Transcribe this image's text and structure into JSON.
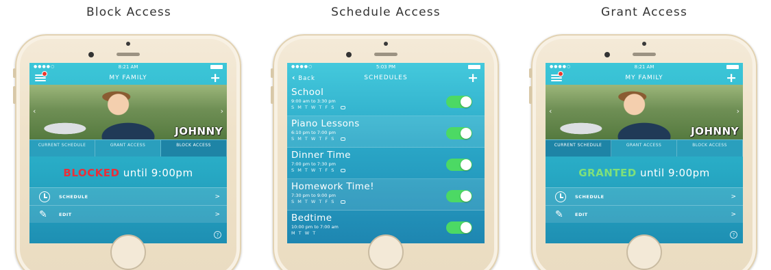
{
  "columns": [
    {
      "title": "Block Access"
    },
    {
      "title": "Schedule Access"
    },
    {
      "title": "Grant Access"
    }
  ],
  "block": {
    "time": "8:21 AM",
    "nav_title": "MY FAMILY",
    "child_name": "JOHNNY",
    "tabs": [
      "CURRENT SCHEDULE",
      "GRANT ACCESS",
      "BLOCK ACCESS"
    ],
    "active_tab": 2,
    "status_word": "BLOCKED",
    "status_rest": " until 9:00pm",
    "rows": [
      {
        "label": "SCHEDULE",
        "icon": "clock-icon"
      },
      {
        "label": "EDIT",
        "icon": "pencil-icon"
      }
    ],
    "help": "?"
  },
  "schedules": {
    "time": "5:03 PM",
    "back_label": "Back",
    "nav_title": "SCHEDULES",
    "items": [
      {
        "title": "School",
        "time": "9:00 am to 3:30 pm",
        "days": "S M T W T F S"
      },
      {
        "title": "Piano Lessons",
        "time": "6:10 pm to 7:00 pm",
        "days": "S M T W T F S"
      },
      {
        "title": "Dinner Time",
        "time": "7:00 pm to 7:30 pm",
        "days": "S M T W T F S"
      },
      {
        "title": "Homework Time!",
        "time": "7:30 pm to 9:00 pm",
        "days": "S M T W T F S"
      },
      {
        "title": "Bedtime",
        "time": "10:00 pm to 7:00 am",
        "days": "M T W T"
      }
    ]
  },
  "grant": {
    "time": "8:21 AM",
    "nav_title": "MY FAMILY",
    "child_name": "JOHNNY",
    "tabs": [
      "CURRENT SCHEDULE",
      "GRANT ACCESS",
      "BLOCK ACCESS"
    ],
    "active_tab": 0,
    "status_word": "GRANTED",
    "status_rest": " until 9:00pm",
    "rows": [
      {
        "label": "SCHEDULE",
        "icon": "clock-icon"
      },
      {
        "label": "EDIT",
        "icon": "pencil-icon"
      }
    ],
    "help": "?"
  }
}
